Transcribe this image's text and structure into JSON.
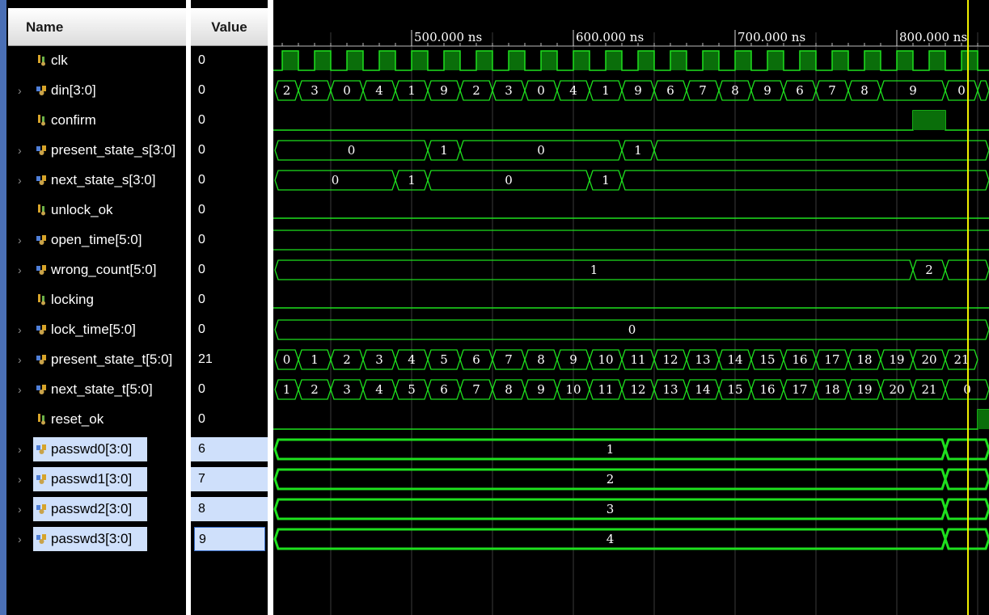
{
  "headers": {
    "name": "Name",
    "value": "Value"
  },
  "timeline": {
    "ticks": [
      "500.000 ns",
      "600.000 ns",
      "700.000 ns",
      "800.000 ns"
    ]
  },
  "signals": [
    {
      "name": "clk",
      "value": "0",
      "kind": "bit",
      "expand": false,
      "selected": false
    },
    {
      "name": "din[3:0]",
      "value": "0",
      "kind": "bus",
      "expand": true,
      "selected": false,
      "wave": [
        "2",
        "3",
        "0",
        "4",
        "1",
        "9",
        "2",
        "3",
        "0",
        "4",
        "1",
        "9",
        "6",
        "7",
        "8",
        "9",
        "6",
        "7",
        "8",
        "9",
        "0"
      ]
    },
    {
      "name": "confirm",
      "value": "0",
      "kind": "bit",
      "expand": false,
      "selected": false
    },
    {
      "name": "present_state_s[3:0]",
      "value": "0",
      "kind": "bus",
      "expand": true,
      "selected": false,
      "wave": [
        "0",
        "1",
        "0",
        "1"
      ]
    },
    {
      "name": "next_state_s[3:0]",
      "value": "0",
      "kind": "bus",
      "expand": true,
      "selected": false,
      "wave": [
        "0",
        "1",
        "0",
        "1"
      ]
    },
    {
      "name": "unlock_ok",
      "value": "0",
      "kind": "bit",
      "expand": false,
      "selected": false
    },
    {
      "name": "open_time[5:0]",
      "value": "0",
      "kind": "bus",
      "expand": true,
      "selected": false
    },
    {
      "name": "wrong_count[5:0]",
      "value": "0",
      "kind": "bus",
      "expand": true,
      "selected": false,
      "wave": [
        "1",
        "2"
      ]
    },
    {
      "name": "locking",
      "value": "0",
      "kind": "bit",
      "expand": false,
      "selected": false
    },
    {
      "name": "lock_time[5:0]",
      "value": "0",
      "kind": "bus",
      "expand": true,
      "selected": false,
      "wave": [
        "0"
      ]
    },
    {
      "name": "present_state_t[5:0]",
      "value": "21",
      "kind": "bus",
      "expand": true,
      "selected": false,
      "wave": [
        "0",
        "1",
        "2",
        "3",
        "4",
        "5",
        "6",
        "7",
        "8",
        "9",
        "10",
        "11",
        "12",
        "13",
        "14",
        "15",
        "16",
        "17",
        "18",
        "19",
        "20",
        "21"
      ]
    },
    {
      "name": "next_state_t[5:0]",
      "value": "0",
      "kind": "bus",
      "expand": true,
      "selected": false,
      "wave": [
        "1",
        "2",
        "3",
        "4",
        "5",
        "6",
        "7",
        "8",
        "9",
        "10",
        "11",
        "12",
        "13",
        "14",
        "15",
        "16",
        "17",
        "18",
        "19",
        "20",
        "21",
        "0"
      ]
    },
    {
      "name": "reset_ok",
      "value": "0",
      "kind": "bit",
      "expand": false,
      "selected": false
    },
    {
      "name": "passwd0[3:0]",
      "value": "6",
      "kind": "bus",
      "expand": true,
      "selected": true,
      "wave": [
        "1"
      ]
    },
    {
      "name": "passwd1[3:0]",
      "value": "7",
      "kind": "bus",
      "expand": true,
      "selected": true,
      "wave": [
        "2"
      ]
    },
    {
      "name": "passwd2[3:0]",
      "value": "8",
      "kind": "bus",
      "expand": true,
      "selected": true,
      "wave": [
        "3"
      ]
    },
    {
      "name": "passwd3[3:0]",
      "value": "9",
      "kind": "bus",
      "expand": true,
      "selected": true,
      "focused": true,
      "wave": [
        "4"
      ]
    }
  ],
  "colors": {
    "wave": "#1ee01e",
    "wave_fill": "#0a6e0a",
    "cursor": "#f0f000",
    "grid": "#3a3a3a",
    "selection": "#cfe0fb"
  }
}
